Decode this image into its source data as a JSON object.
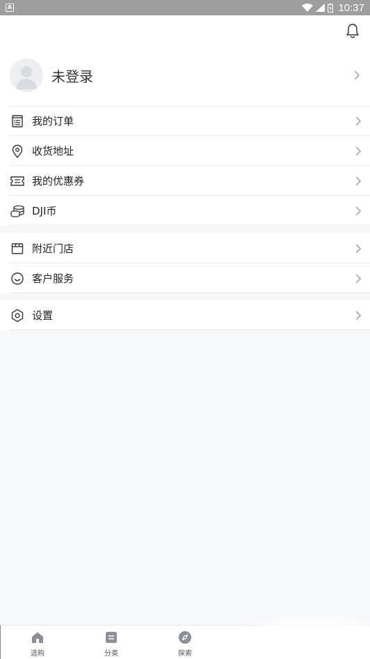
{
  "status_bar": {
    "notification_glyph": "A",
    "time": "10:37"
  },
  "header": {
    "bell_icon": "bell-icon"
  },
  "profile": {
    "name": "未登录"
  },
  "menu_groups": [
    [
      {
        "label": "我的订单",
        "icon": "order-list-icon"
      },
      {
        "label": "收货地址",
        "icon": "location-pin-icon"
      },
      {
        "label": "我的优惠券",
        "icon": "coupon-ticket-icon"
      },
      {
        "label": "DJI币",
        "icon": "coin-stack-icon"
      }
    ],
    [
      {
        "label": "附近门店",
        "icon": "store-icon"
      },
      {
        "label": "客户服务",
        "icon": "customer-service-icon"
      }
    ],
    [
      {
        "label": "设置",
        "icon": "settings-hexagon-icon"
      }
    ]
  ],
  "tabbar": [
    {
      "label": "选购",
      "icon": "home-shop-icon"
    },
    {
      "label": "分类",
      "icon": "category-list-icon"
    },
    {
      "label": "探索",
      "icon": "compass-icon"
    }
  ],
  "colors": {
    "background": "#f7f8fa",
    "divider": "#e8e8e8",
    "status_bar": "#9e9e9e",
    "tab_icon": "#8a8f99"
  }
}
